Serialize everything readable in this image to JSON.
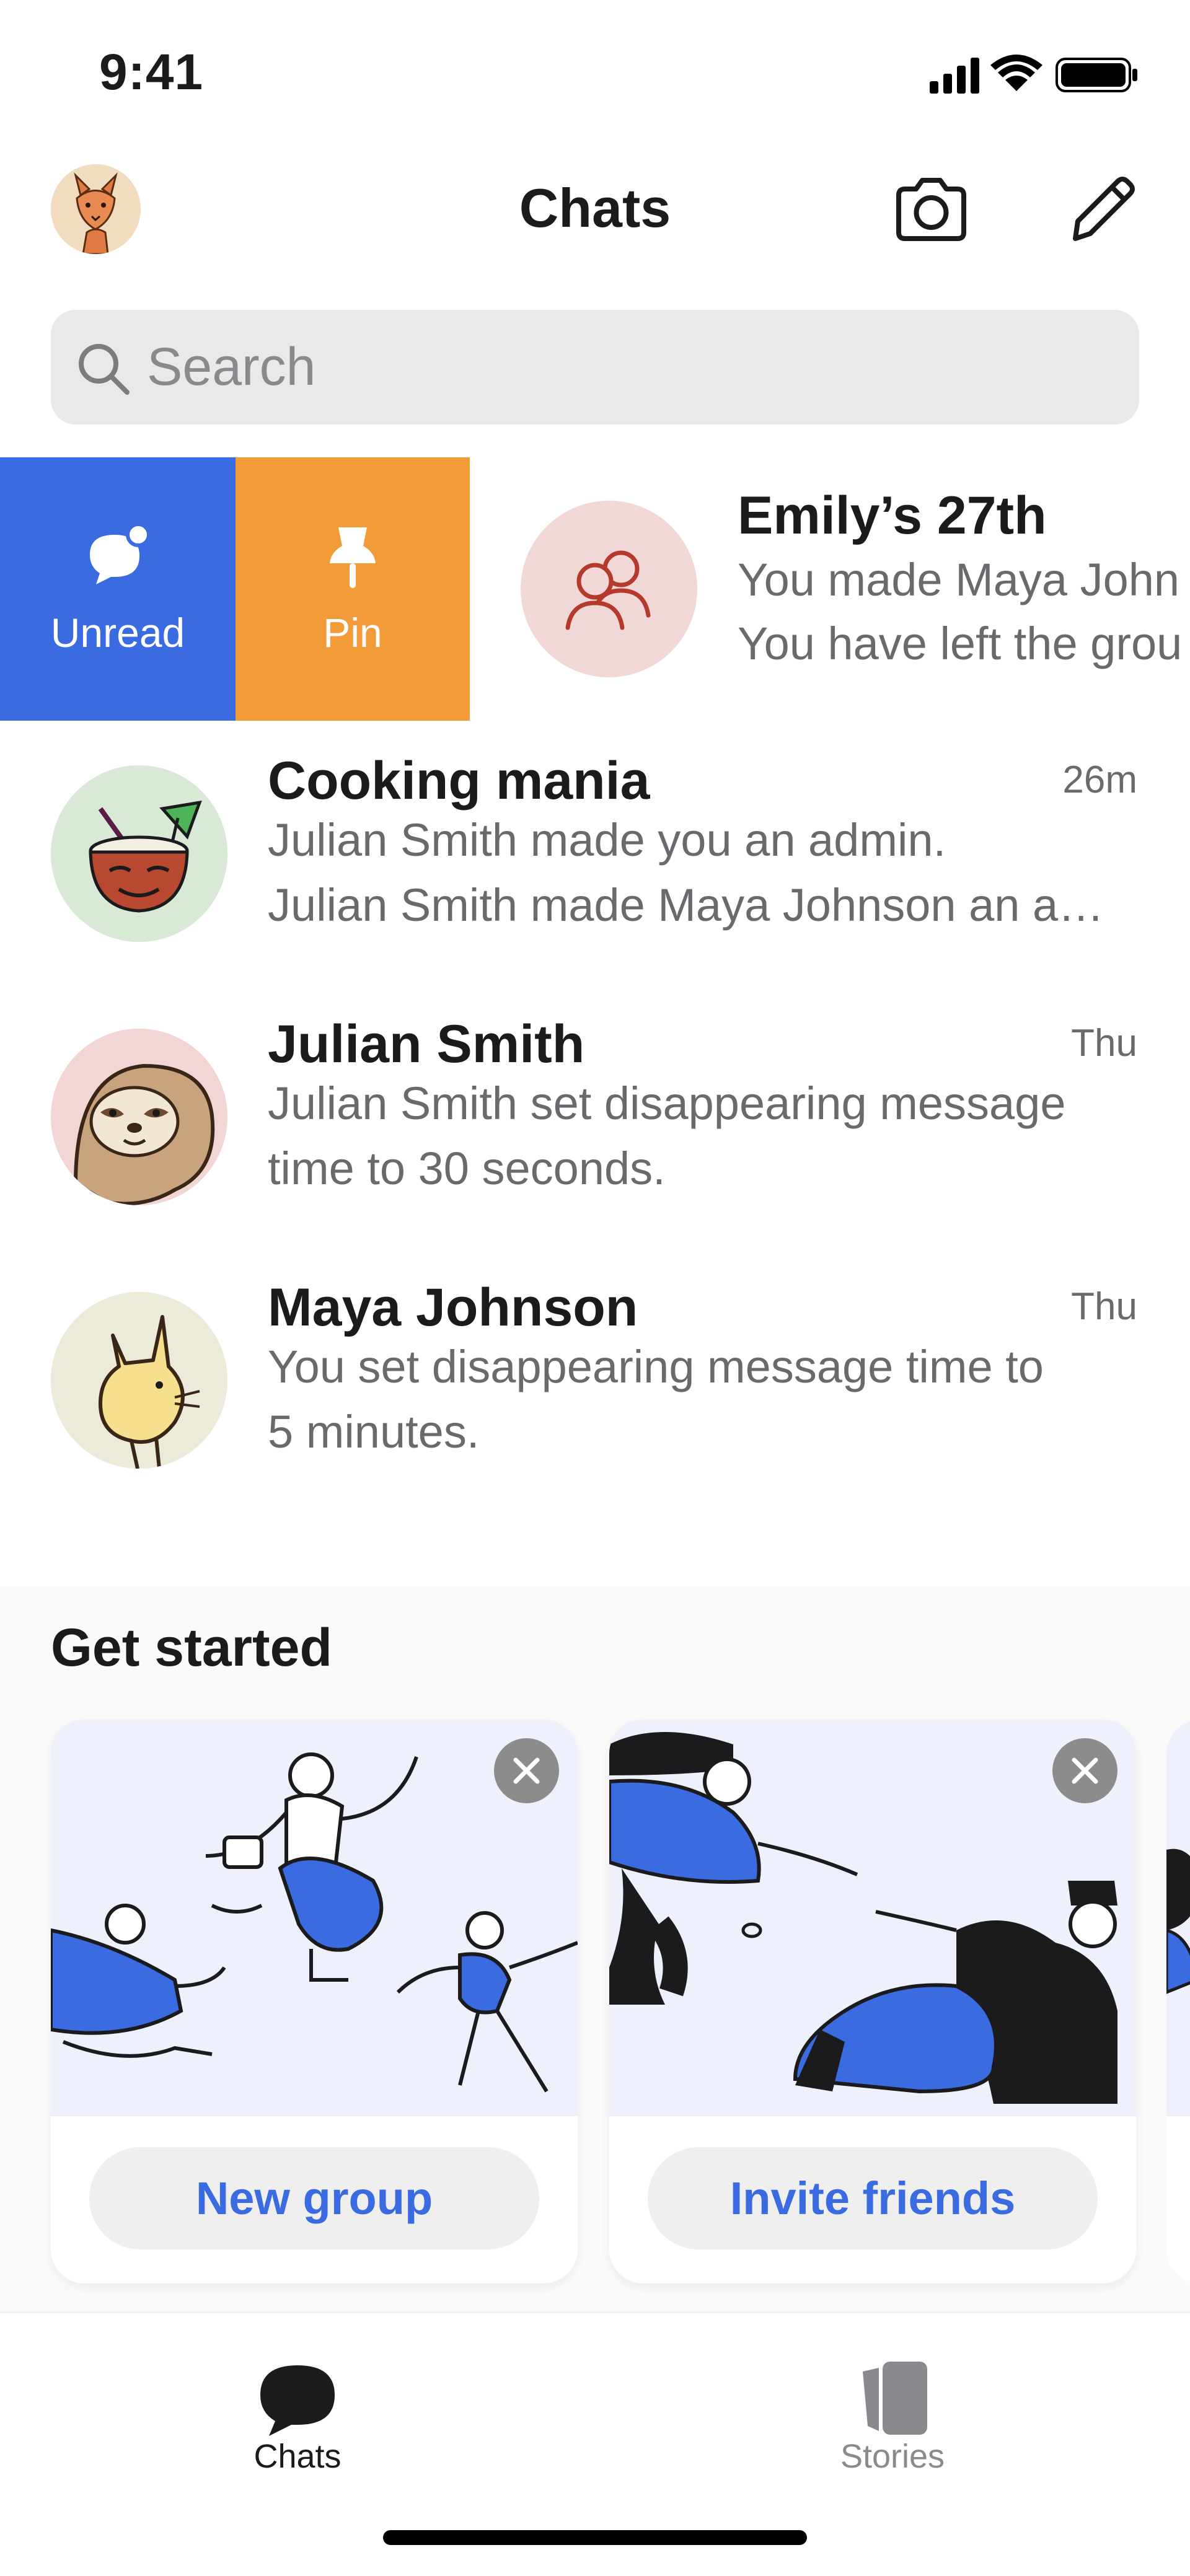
{
  "status_bar": {
    "time": "9:41"
  },
  "header": {
    "title": "Chats",
    "camera_icon": "camera-icon",
    "compose_icon": "compose-icon"
  },
  "search": {
    "placeholder": "Search"
  },
  "swipe_row": {
    "actions": [
      {
        "label": "Unread",
        "icon": "unread-icon",
        "color": "#3b6be0"
      },
      {
        "label": "Pin",
        "icon": "pin-icon",
        "color": "#f29b39"
      }
    ],
    "chat": {
      "name": "Emily’s 27th",
      "line1": "You made Maya John",
      "line2": "You have left the grou"
    }
  },
  "chats": [
    {
      "name": "Cooking mania",
      "time": "26m",
      "line1": "Julian Smith made you an admin.",
      "line2": "Julian Smith made Maya Johnson an a…"
    },
    {
      "name": "Julian Smith",
      "time": "Thu",
      "line1": "Julian  Smith set disappearing message",
      "line2": "time to 30 seconds."
    },
    {
      "name": "Maya Johnson",
      "time": "Thu",
      "line1": "You set disappearing message time to",
      "line2": "5 minutes."
    }
  ],
  "get_started": {
    "title": "Get started",
    "cards": [
      {
        "button": "New group"
      },
      {
        "button": "Invite friends"
      }
    ]
  },
  "tabs": [
    {
      "label": "Chats",
      "icon": "chat-bubble-icon",
      "active": true
    },
    {
      "label": "Stories",
      "icon": "stories-icon",
      "active": false
    }
  ],
  "colors": {
    "accent": "#3b6be0",
    "pin": "#f29b39",
    "text": "#1b1b1d",
    "secondary": "#6a6a6e"
  }
}
